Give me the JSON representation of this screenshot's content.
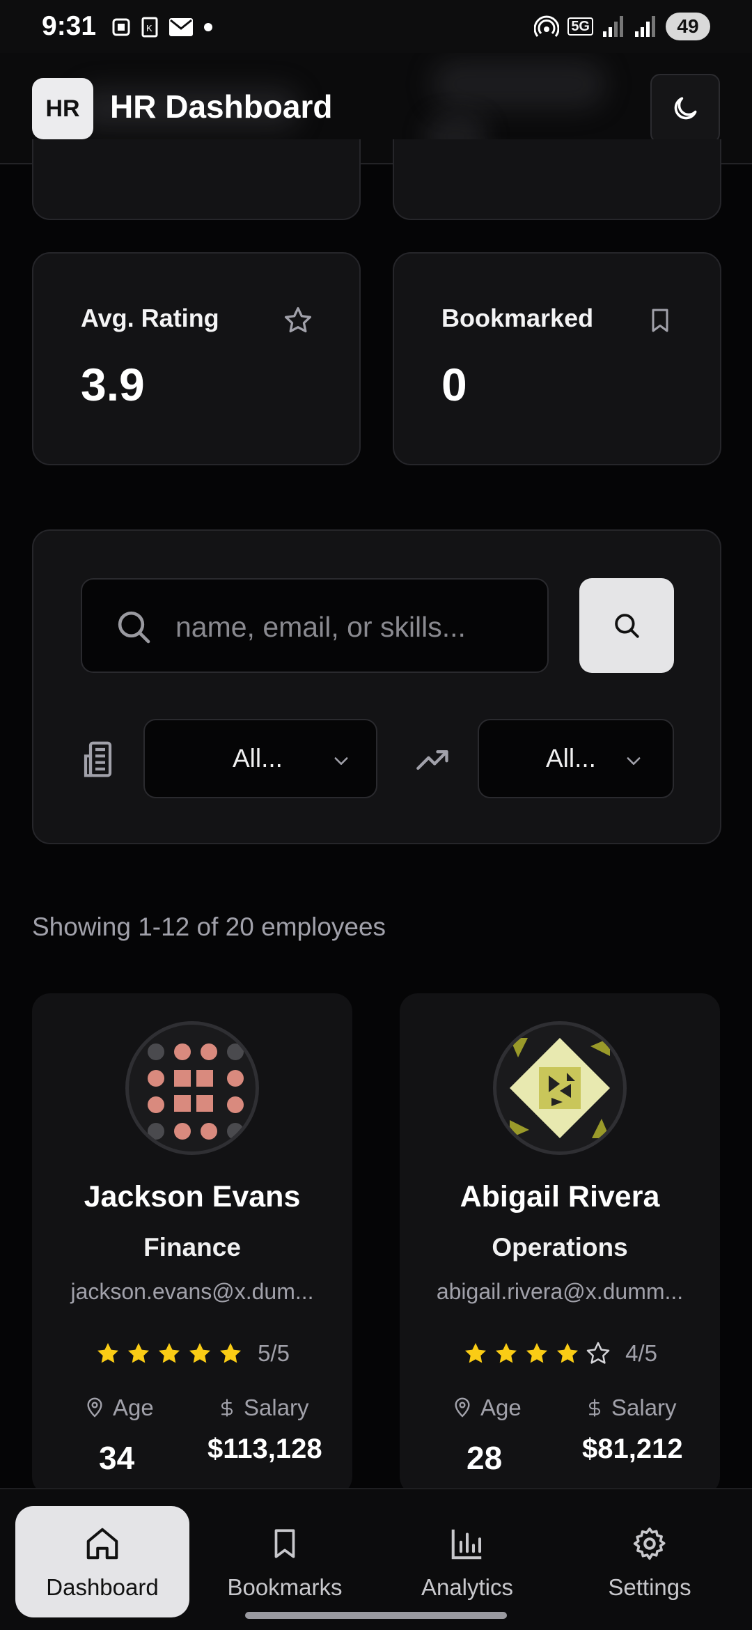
{
  "status_bar": {
    "time": "9:31",
    "network": "5G",
    "battery": "49"
  },
  "header": {
    "logo_text": "HR",
    "title": "HR Dashboard",
    "theme_icon": "moon-icon"
  },
  "stats": [
    {
      "label": "Avg. Rating",
      "value": "3.9",
      "icon": "star-icon"
    },
    {
      "label": "Bookmarked",
      "value": "0",
      "icon": "bookmark-icon"
    }
  ],
  "search": {
    "placeholder": "name, email, or skills...",
    "value": ""
  },
  "filters": {
    "department": {
      "icon": "building-icon",
      "selected": "All..."
    },
    "performance": {
      "icon": "trending-up-icon",
      "selected": "All..."
    }
  },
  "results": {
    "summary": "Showing 1-12 of 20 employees"
  },
  "employees": [
    {
      "name": "Jackson Evans",
      "department": "Finance",
      "email": "jackson.evans@x.dum...",
      "rating": 5,
      "rating_text": "5/5",
      "age_label": "Age",
      "age": "34",
      "salary_label": "Salary",
      "salary": "$113,128",
      "avatar_color": "#d98a7e"
    },
    {
      "name": "Abigail Rivera",
      "department": "Operations",
      "email": "abigail.rivera@x.dumm...",
      "rating": 4,
      "rating_text": "4/5",
      "age_label": "Age",
      "age": "28",
      "salary_label": "Salary",
      "salary": "$81,212",
      "avatar_color": "#c9c65a"
    }
  ],
  "nav": [
    {
      "label": "Dashboard",
      "icon": "home-icon",
      "active": true
    },
    {
      "label": "Bookmarks",
      "icon": "bookmark-icon",
      "active": false
    },
    {
      "label": "Analytics",
      "icon": "bar-chart-icon",
      "active": false
    },
    {
      "label": "Settings",
      "icon": "gear-icon",
      "active": false
    }
  ],
  "colors": {
    "accent_star": "#facc15",
    "background": "#050506",
    "card": "#131315"
  }
}
